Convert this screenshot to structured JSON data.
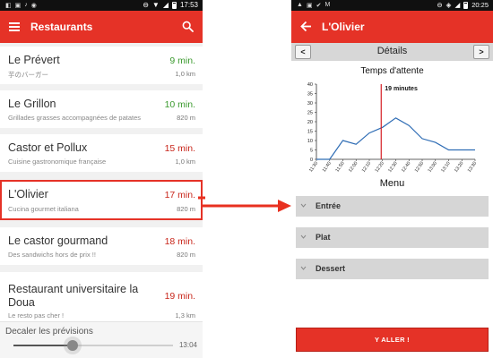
{
  "left_screen": {
    "status_bar": {
      "time": "17:53",
      "left_icons": [
        "◧",
        "▣",
        "♪",
        "◉"
      ],
      "right_icons": [
        "⊖",
        "▼",
        "◢"
      ]
    },
    "app_bar": {
      "title": "Restaurants",
      "menu_icon": "hamburger-icon",
      "search_icon": "search-icon"
    },
    "restaurants": [
      {
        "name": "Le Prévert",
        "subtitle": "芋のバーガー",
        "time": "9 min.",
        "distance": "1,0 km",
        "time_color": "green",
        "selected": false
      },
      {
        "name": "Le Grillon",
        "subtitle": "Grillades grasses accompagnées de patates",
        "time": "10 min.",
        "distance": "820 m",
        "time_color": "green",
        "selected": false
      },
      {
        "name": "Castor et Pollux",
        "subtitle": "Cuisine gastronomique française",
        "time": "15 min.",
        "distance": "1,0 km",
        "time_color": "red",
        "selected": false
      },
      {
        "name": "L'Olivier",
        "subtitle": "Cucina gourmet italiana",
        "time": "17 min.",
        "distance": "820 m",
        "time_color": "red",
        "selected": true
      },
      {
        "name": "Le castor gourmand",
        "subtitle": "Des sandwichs hors de prix !!",
        "time": "18 min.",
        "distance": "820 m",
        "time_color": "red",
        "selected": false
      },
      {
        "name": "Restaurant universitaire la Doua",
        "subtitle": "Le resto pas cher !",
        "time": "19 min.",
        "distance": "1,3 km",
        "time_color": "red",
        "selected": false
      }
    ],
    "slider": {
      "label": "Decaler les prévisions",
      "value": "13:04",
      "position_fraction": 0.37
    }
  },
  "right_screen": {
    "status_bar": {
      "time": "20:25",
      "left_icons": [
        "▲",
        "▣",
        "✔",
        "M"
      ],
      "right_icons": [
        "⊖",
        "◈",
        "◢"
      ]
    },
    "app_bar": {
      "title": "L'Olivier",
      "back_icon": "back-arrow-icon"
    },
    "details_bar": {
      "title": "Détails",
      "prev_label": "<",
      "next_label": ">"
    },
    "menu_title": "Menu",
    "menu_sections": [
      "Entrée",
      "Plat",
      "Dessert"
    ],
    "go_button": "Y ALLER !"
  },
  "colors": {
    "brand_red": "#e53227",
    "line_blue": "#2f6db5",
    "marker_red": "#d41f26",
    "green": "#3b9a2e"
  },
  "chart_data": {
    "type": "line",
    "title": "Temps d'attente",
    "xlabel": "",
    "ylabel": "",
    "x": [
      "11:30",
      "11:40",
      "11:50",
      "12:00",
      "12:10",
      "12:20",
      "12:30",
      "12:40",
      "12:50",
      "13:00",
      "13:10",
      "13:20",
      "13:30"
    ],
    "series": [
      {
        "values": [
          0,
          0,
          10,
          8,
          14,
          17,
          22,
          18,
          11,
          9,
          5,
          5,
          5
        ]
      }
    ],
    "ylim": [
      0,
      40
    ],
    "yticks": [
      0,
      5,
      10,
      15,
      20,
      25,
      30,
      35,
      40
    ],
    "grid": false,
    "marker": {
      "x": "12:19",
      "label": "19 minutes"
    }
  }
}
